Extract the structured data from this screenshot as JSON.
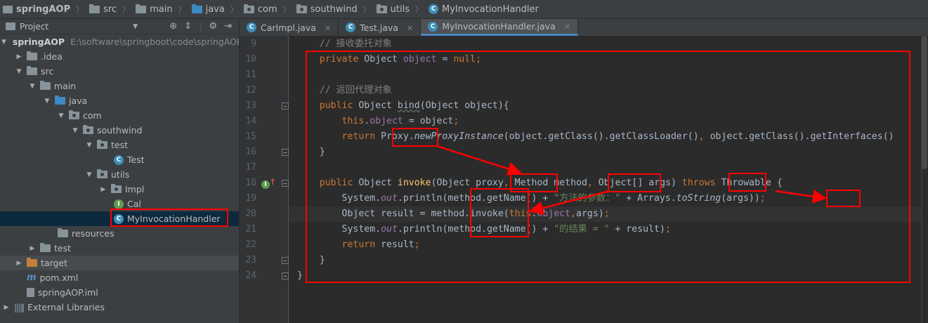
{
  "breadcrumb": [
    {
      "label": "springAOP",
      "icon": "project-folder-icon"
    },
    {
      "label": "src",
      "icon": "folder-icon"
    },
    {
      "label": "main",
      "icon": "folder-icon"
    },
    {
      "label": "java",
      "icon": "source-folder-icon"
    },
    {
      "label": "com",
      "icon": "package-icon"
    },
    {
      "label": "southwind",
      "icon": "package-icon"
    },
    {
      "label": "utils",
      "icon": "package-icon"
    },
    {
      "label": "MyInvocationHandler",
      "icon": "class-icon"
    }
  ],
  "project_panel": {
    "title": "Project",
    "tree": [
      {
        "label": "springAOP",
        "path": "E:\\software\\springboot\\code\\springAOP"
      },
      {
        "label": ".idea"
      },
      {
        "label": "src"
      },
      {
        "label": "main"
      },
      {
        "label": "java"
      },
      {
        "label": "com"
      },
      {
        "label": "southwind"
      },
      {
        "label": "test"
      },
      {
        "label": "Test"
      },
      {
        "label": "utils"
      },
      {
        "label": "Impl"
      },
      {
        "label": "Cal"
      },
      {
        "label": "MyInvocationHandler"
      },
      {
        "label": "resources"
      },
      {
        "label": "test"
      },
      {
        "label": "target"
      },
      {
        "label": "pom.xml"
      },
      {
        "label": "springAOP.iml"
      },
      {
        "label": "External Libraries"
      }
    ]
  },
  "tabs": [
    {
      "label": "CarImpl.java",
      "close": "×"
    },
    {
      "label": "Test.java",
      "close": "×"
    },
    {
      "label": "MyInvocationHandler.java",
      "close": "×",
      "active": true
    }
  ],
  "editor": {
    "line_numbers": [
      "9",
      "10",
      "11",
      "12",
      "13",
      "14",
      "15",
      "16",
      "17",
      "18",
      "19",
      "20",
      "21",
      "22",
      "23",
      "24"
    ],
    "current_line": "20",
    "lines": {
      "l9_comment": "    // 接收委托对象",
      "l10_kw": "    private ",
      "l10_type": "Object ",
      "l10_field": "object",
      "l10_eq": " = ",
      "l10_null": "null",
      "l10_semi": ";",
      "l12_comment": "    // 返回代理对象",
      "l13_kw": "    public ",
      "l13_type": "Object ",
      "l13_method": "bind",
      "l13_rest": "(Object object){",
      "l14_kw": "        this",
      "l14_dot": ".",
      "l14_field": "object",
      "l14_rest": " = object",
      "l14_semi": ";",
      "l15_kw": "        return ",
      "l15_proxy": "Proxy.",
      "l15_static": "newProxyInstance",
      "l15_rest": "(object.getClass().getClassLoader()",
      "l15_comma": ", ",
      "l15_rest2": "object.getClass().getInterfaces()",
      "l16": "    }",
      "l18_kw": "    public ",
      "l18_type": "Object ",
      "l18_method": "invoke",
      "l18_p1": "(Object proxy",
      "l18_c1": ", ",
      "l18_p2": "Method method",
      "l18_c2": ", ",
      "l18_p3": "Object[] args) ",
      "l18_throws": "throws ",
      "l18_end": "Throwable {",
      "l19_a": "        System.",
      "l19_out": "out",
      "l19_b": ".println(method.getName() + ",
      "l19_str": "\"方法的参数：\"",
      "l19_c": " + Arrays.",
      "l19_static": "toString",
      "l19_d": "(args))",
      "l19_semi": ";",
      "l20_a": "        Object result = method.invoke(",
      "l20_this": "this",
      "l20_dot": ".",
      "l20_field": "object",
      "l20_comma": ",",
      "l20_b": "args)",
      "l20_semi": ";",
      "l21_a": "        System.",
      "l21_out": "out",
      "l21_b": ".println(method.getName() + ",
      "l21_str": "\"的结果 = \"",
      "l21_c": " + result)",
      "l21_semi": ";",
      "l22_kw": "        return ",
      "l22_rest": "result",
      "l22_semi": ";",
      "l23": "    }",
      "l24": "}"
    }
  },
  "colors": {
    "annotation_red": "#ff0000",
    "keyword": "#cc7832",
    "comment": "#808080",
    "field": "#9876aa",
    "string": "#6a8759",
    "method_decl": "#ffc66d"
  }
}
